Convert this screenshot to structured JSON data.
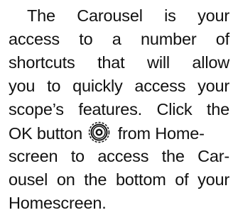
{
  "paragraph": {
    "lines": [
      "The Carousel is your",
      "access to a number of",
      "shortcuts that will allow",
      "you to quickly access your",
      "scope’s features. Click the"
    ],
    "line6_before": "OK button",
    "line6_after": "from Home-",
    "line7": "screen to access the Car-",
    "line8": "ousel on the bottom of your",
    "line9": "Homescreen."
  },
  "icons": {
    "ok_button": "ok-button-icon"
  }
}
